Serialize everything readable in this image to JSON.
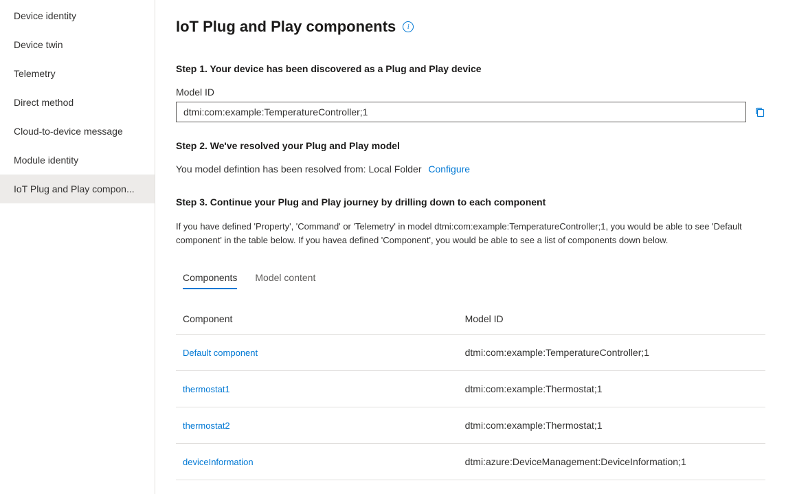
{
  "sidebar": {
    "items": [
      {
        "label": "Device identity"
      },
      {
        "label": "Device twin"
      },
      {
        "label": "Telemetry"
      },
      {
        "label": "Direct method"
      },
      {
        "label": "Cloud-to-device message"
      },
      {
        "label": "Module identity"
      },
      {
        "label": "IoT Plug and Play compon..."
      }
    ],
    "activeIndex": 6
  },
  "page": {
    "title": "IoT Plug and Play components"
  },
  "step1": {
    "heading": "Step 1. Your device has been discovered as a Plug and Play device",
    "modelIdLabel": "Model ID",
    "modelIdValue": "dtmi:com:example:TemperatureController;1"
  },
  "step2": {
    "heading": "Step 2. We've resolved your Plug and Play model",
    "resolvedText": "You model defintion has been resolved from: Local Folder",
    "configureLabel": "Configure"
  },
  "step3": {
    "heading": "Step 3. Continue your Plug and Play journey by drilling down to each component",
    "infoText": "If you have defined 'Property', 'Command' or 'Telemetry' in model dtmi:com:example:TemperatureController;1, you would be able to see 'Default component' in the table below. If you havea defined 'Component', you would be able to see a list of components down below."
  },
  "tabs": {
    "items": [
      {
        "label": "Components"
      },
      {
        "label": "Model content"
      }
    ],
    "activeIndex": 0
  },
  "table": {
    "headers": {
      "component": "Component",
      "modelId": "Model ID"
    },
    "rows": [
      {
        "component": "Default component",
        "modelId": "dtmi:com:example:TemperatureController;1"
      },
      {
        "component": "thermostat1",
        "modelId": "dtmi:com:example:Thermostat;1"
      },
      {
        "component": "thermostat2",
        "modelId": "dtmi:com:example:Thermostat;1"
      },
      {
        "component": "deviceInformation",
        "modelId": "dtmi:azure:DeviceManagement:DeviceInformation;1"
      }
    ]
  }
}
